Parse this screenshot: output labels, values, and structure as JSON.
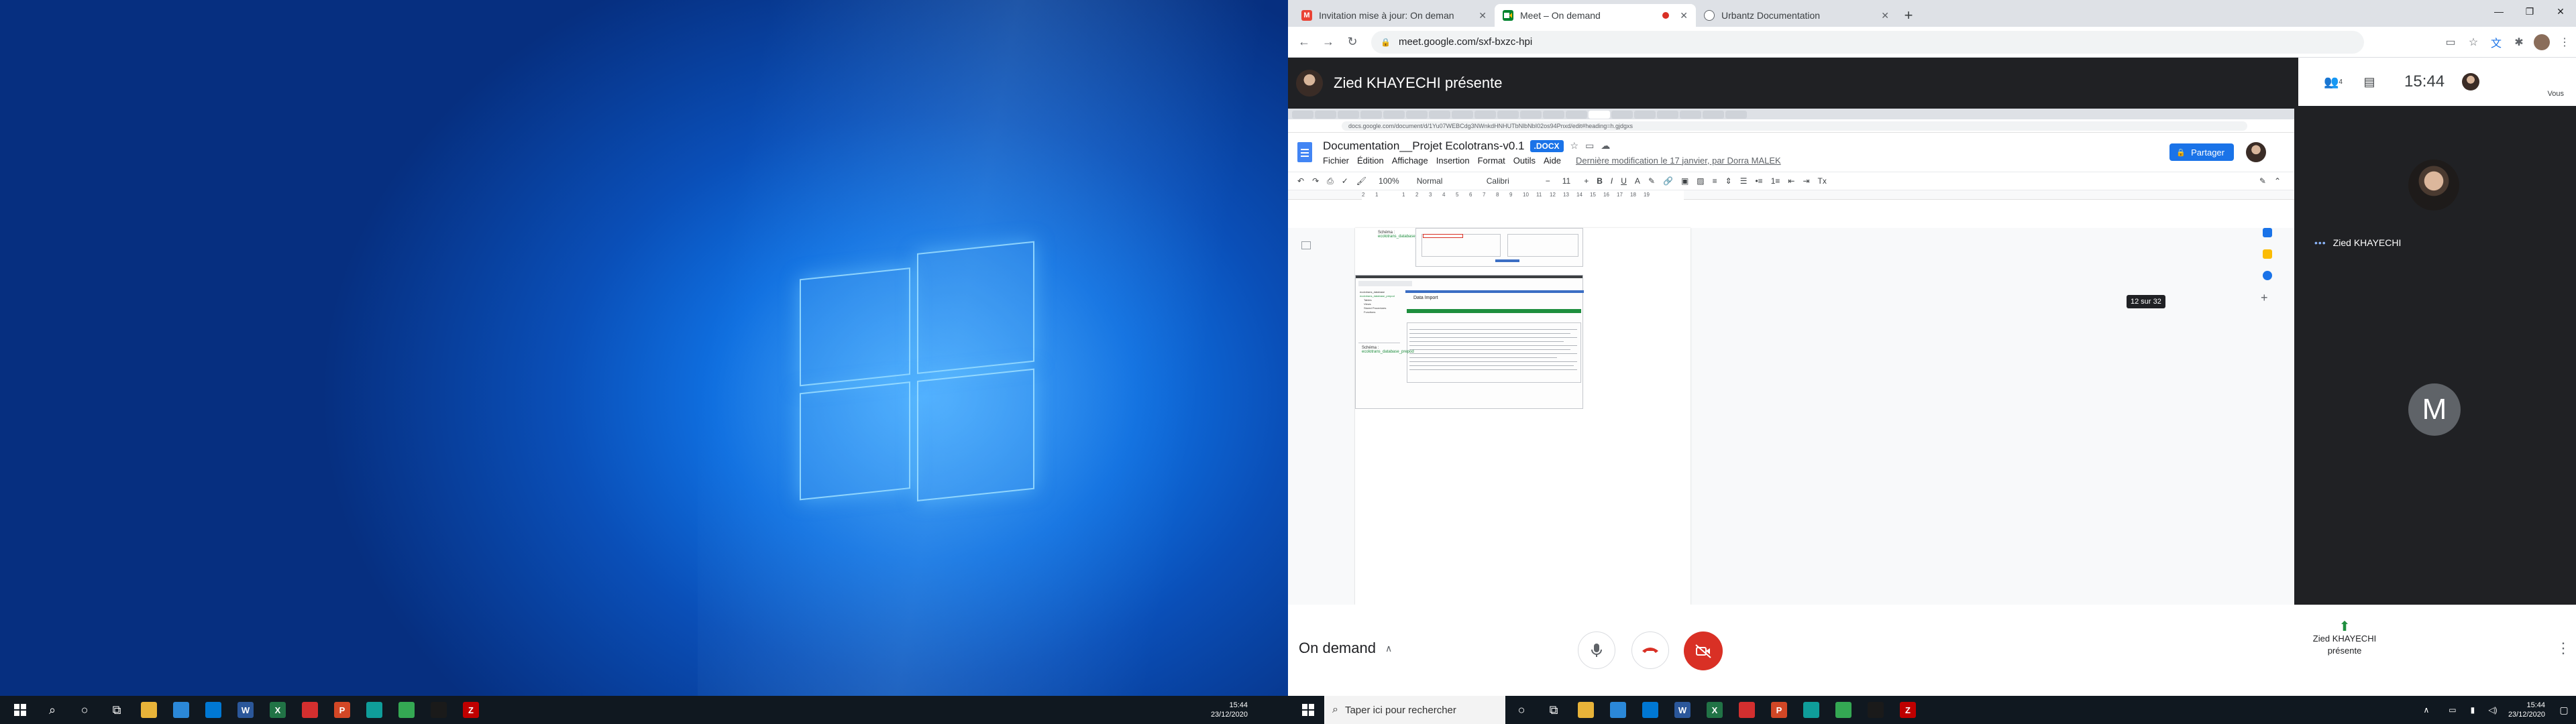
{
  "left_screen": {
    "taskbar": {
      "apps": [
        {
          "icon": "file-explorer-icon",
          "color": "#e8b339"
        },
        {
          "icon": "store-icon",
          "color": "#2b88d8"
        },
        {
          "icon": "mail-icon",
          "color": "#0078d4"
        },
        {
          "icon": "word-icon",
          "color": "#2b579a",
          "glyph": "W"
        },
        {
          "icon": "excel-icon",
          "color": "#217346",
          "glyph": "X"
        },
        {
          "icon": "acrobat-icon",
          "color": "#d32f2f"
        },
        {
          "icon": "powerpoint-icon",
          "color": "#d24726",
          "glyph": "P"
        },
        {
          "icon": "edge-icon",
          "color": "#0f9d9a"
        },
        {
          "icon": "chrome-icon",
          "color": "#34a853"
        },
        {
          "icon": "toad-icon",
          "color": "#1a1a1a"
        },
        {
          "icon": "filezilla-icon",
          "color": "#bf0000",
          "glyph": "Z"
        }
      ],
      "time": "15:44",
      "date": "23/12/2020"
    }
  },
  "browser": {
    "tabs": [
      {
        "title": "Invitation mise à jour: On deman",
        "favicon": "gmail-icon",
        "color": "#ea4335",
        "glyph": "M",
        "active": false
      },
      {
        "title": "Meet – On demand",
        "favicon": "meet-icon",
        "color": "#00832d",
        "glyph": "",
        "active": true
      },
      {
        "title": "Urbantz Documentation",
        "favicon": "globe-icon",
        "color": "#5f6368",
        "glyph": "",
        "active": false
      }
    ],
    "new_tab_label": "+",
    "url": "meet.google.com/sxf-bxzc-hpi"
  },
  "meet": {
    "presenter_label": "Zied KHAYECHI présente",
    "time": "15:44",
    "self_label": "Vous",
    "participant_count": "4",
    "participants": [
      {
        "name": "Zied KHAYECHI",
        "kind": "photo"
      },
      {
        "name": "",
        "initial": "M",
        "kind": "initial"
      }
    ],
    "meeting_name": "On demand",
    "presenting_label": "Zied KHAYECHI présente"
  },
  "shared_doc": {
    "url": "docs.google.com/document/d/1Yu07WEBCdg3NWnkdHNHUTbNlbNbI02os94Pnxd/edit#heading=h.gjdgxs",
    "title": "Documentation__Projet Ecolotrans-v0.1",
    "badge": ".DOCX",
    "menu": [
      "Fichier",
      "Édition",
      "Affichage",
      "Insertion",
      "Format",
      "Outils",
      "Aide"
    ],
    "last_modified": "Dernière modification le 17 janvier, par Dorra MALEK",
    "share_label": "Partager",
    "toolbar": {
      "zoom": "100%",
      "style": "Normal",
      "font": "Calibri",
      "size": "11"
    },
    "ruler": [
      "2",
      "1",
      "",
      "1",
      "2",
      "3",
      "4",
      "5",
      "6",
      "7",
      "8",
      "9",
      "10",
      "11",
      "12",
      "13",
      "14",
      "15",
      "16",
      "17",
      "18",
      "19"
    ],
    "page_indicator": "12 sur 32",
    "embedded": {
      "schema_label": "Schéma :",
      "schema_value": "ecolotrans_database_prepod",
      "dialog_title": "Data Import",
      "tree_items": [
        "ecolotrans_database",
        "ecolotrans_database_prepod",
        "Tables",
        "Views",
        "Stored Procedures",
        "Functions"
      ]
    }
  },
  "right_taskbar": {
    "search_placeholder": "Taper ici pour rechercher",
    "time": "15:44",
    "date": "23/12/2020"
  }
}
